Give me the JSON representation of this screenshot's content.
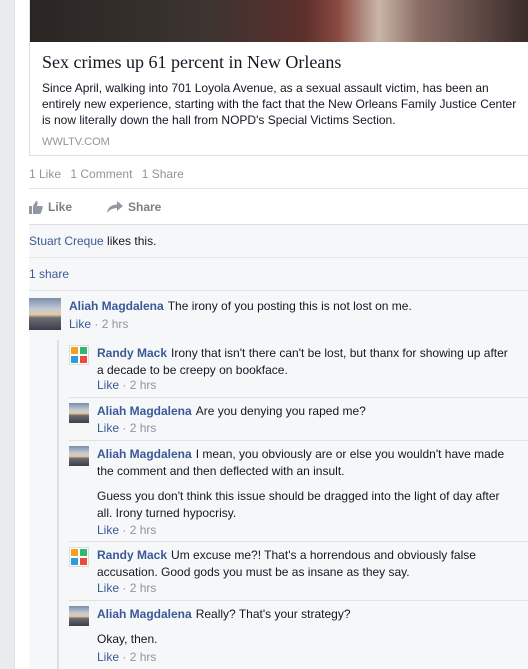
{
  "link": {
    "title": "Sex crimes up 61 percent in New Orleans",
    "description": "Since April, walking into 701 Loyola Avenue, as a sexual assault victim, has been an entirely new experience, starting with the fact that the New Orleans Family Justice Center is now literally down the hall from NOPD's Special Victims Section.",
    "source": "WWLTV.COM"
  },
  "stats": {
    "likes": "1 Like",
    "comments": "1 Comment",
    "shares": "1 Share"
  },
  "actions": {
    "like": "Like",
    "share": "Share"
  },
  "liked_by": {
    "name": "Stuart Creque",
    "suffix": " likes this."
  },
  "share_count": "1 share",
  "comments": [
    {
      "author": "Aliah Magdalena",
      "text": "The irony of you posting this is not lost on me.",
      "like": "Like",
      "time": "2 hrs"
    }
  ],
  "replies": [
    {
      "author": "Randy Mack",
      "text": "Irony that isn't there can't be lost, but thanx for showing up after a decade to be creepy on bookface.",
      "like": "Like",
      "time": "2 hrs"
    },
    {
      "author": "Aliah Magdalena",
      "text": "Are you denying you raped me?",
      "like": "Like",
      "time": "2 hrs"
    },
    {
      "author": "Aliah Magdalena",
      "text": "I mean, you obviously are or else you wouldn't have made the comment and then deflected with an insult.",
      "text2": "Guess you don't think this issue should be dragged into the light of day after all. Irony turned hypocrisy.",
      "like": "Like",
      "time": "2 hrs"
    },
    {
      "author": "Randy Mack",
      "text": "Um excuse me?! That's a horrendous and obviously false accusation. Good gods you must be as insane as they say.",
      "like": "Like",
      "time": "2 hrs"
    },
    {
      "author": "Aliah Magdalena",
      "text": "Really? That's your strategy?",
      "text2": "Okay, then.",
      "like": "Like",
      "time": "2 hrs"
    }
  ],
  "separator": " · "
}
